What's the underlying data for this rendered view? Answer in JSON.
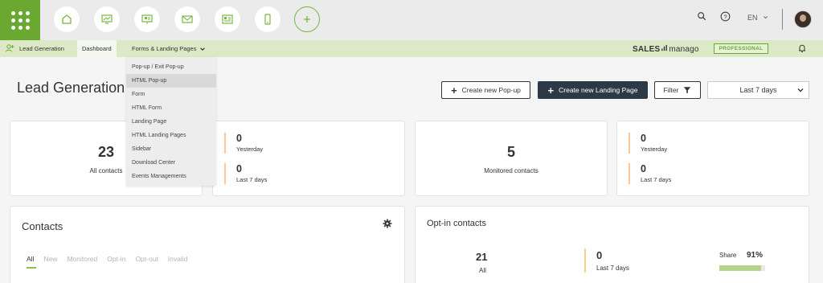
{
  "topbar": {
    "nav_icons": [
      "home-icon",
      "monitor-chart-icon",
      "presentation-icon",
      "mail-icon",
      "contact-card-icon",
      "mobile-icon",
      "plus-icon"
    ],
    "language": "EN",
    "right_icons": [
      "search-icon",
      "help-icon",
      "chevron-down-icon"
    ]
  },
  "subbar": {
    "module_label": "Lead Generation",
    "tab_dashboard": "Dashboard",
    "tab_forms": "Forms & Landing Pages",
    "brand_left": "SALES",
    "brand_right": "manago",
    "plan": "PROFESSIONAL"
  },
  "dropdown": {
    "items": [
      "Pop-up / Exit Pop-up",
      "HTML Pop-up",
      "Form",
      "HTML Form",
      "Landing Page",
      "HTML Landing Pages",
      "Sidebar",
      "Download Center",
      "Events Managements"
    ],
    "highlighted_index": 1
  },
  "header": {
    "title": "Lead Generation",
    "btn_popup": "Create new Pop-up",
    "btn_landing": "Create new Landing Page",
    "btn_filter": "Filter",
    "date_range": "Last 7 days"
  },
  "stats": {
    "all_contacts": {
      "value": "23",
      "label": "All contacts"
    },
    "all_contacts_detail": {
      "yesterday_value": "0",
      "yesterday_label": "Yesterday",
      "week_value": "0",
      "week_label": "Last 7 days"
    },
    "monitored": {
      "value": "5",
      "label": "Monitored contacts"
    },
    "monitored_detail": {
      "yesterday_value": "0",
      "yesterday_label": "Yesterday",
      "week_value": "0",
      "week_label": "Last 7 days"
    }
  },
  "contacts": {
    "title": "Contacts",
    "tabs": [
      "All",
      "New",
      "Monitored",
      "Opt-in",
      "Opt-out",
      "Invalid"
    ],
    "active_tab": "All"
  },
  "optin": {
    "title": "Opt-in contacts",
    "all_value": "21",
    "all_label": "All",
    "week_value": "0",
    "week_label": "Last 7 days",
    "share_label": "Share",
    "share_value": "91%",
    "share_fraction": 0.91
  },
  "colors": {
    "brand_green": "#6aa832",
    "subbar_bg": "#dce9c6",
    "dark_button": "#2c3a47",
    "accent_bar": "#f7c99b"
  }
}
